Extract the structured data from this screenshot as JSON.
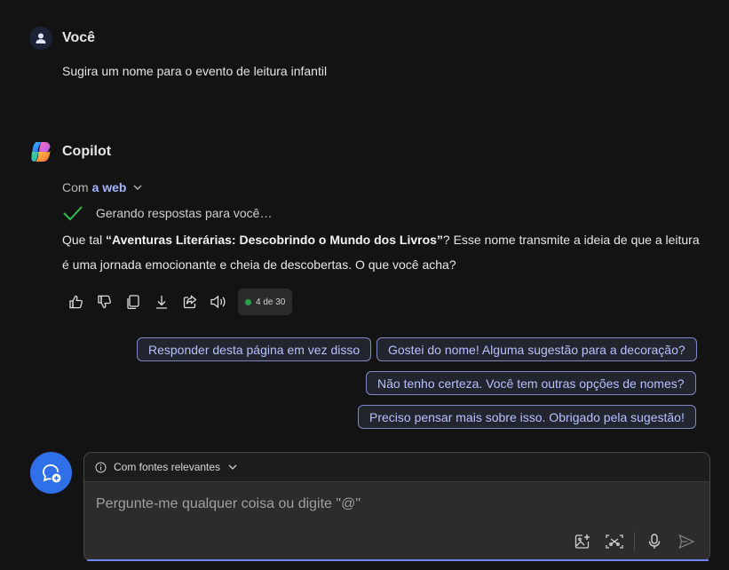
{
  "user": {
    "name": "Você",
    "message": "Sugira um nome para o evento de leitura infantil"
  },
  "assistant": {
    "name": "Copilot",
    "source_prefix": "Com",
    "source_link": "a web",
    "generating": "Gerando respostas para você…",
    "answer": {
      "before": "Que tal ",
      "bold": "“Aventuras Literárias: Descobrindo o Mundo dos Livros”",
      "after": "? Esse nome transmite a ideia de que a leitura é uma jornada emocionante e cheia de descobertas. O que você acha?"
    },
    "counter": "4 de 30"
  },
  "actions": [
    "thumbs-up-icon",
    "thumbs-down-icon",
    "copy-icon",
    "download-icon",
    "share-icon",
    "speaker-icon"
  ],
  "suggestions": [
    "Responder desta página em vez disso",
    "Gostei do nome! Alguma sugestão para a decoração?",
    "Não tenho certeza. Você tem outras opções de nomes?",
    "Preciso pensar mais sobre isso. Obrigado pela sugestão!"
  ],
  "composer": {
    "mode_label": "Com fontes relevantes",
    "placeholder": "Pergunte-me qualquer coisa ou digite \"@\""
  },
  "colors": {
    "background": "#131313",
    "accent": "#2f6fe8",
    "link": "#a6b4ff",
    "success": "#27a04a"
  }
}
